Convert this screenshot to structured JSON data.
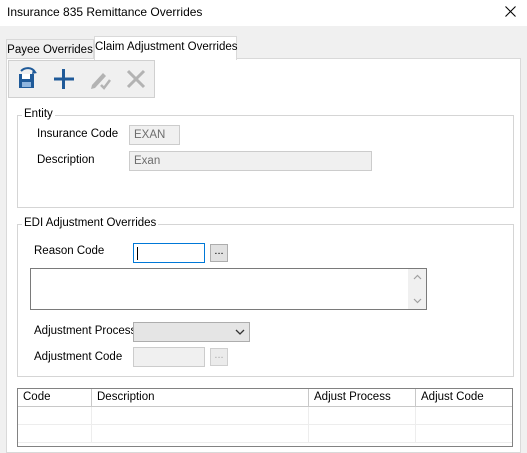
{
  "window": {
    "title": "Insurance 835 Remittance Overrides"
  },
  "tabs": [
    {
      "label": "Payee Overrides",
      "active": false
    },
    {
      "label": "Claim Adjustment Overrides",
      "active": true
    }
  ],
  "toolbar": {
    "buttons": [
      {
        "icon": "save-icon",
        "enabled": true
      },
      {
        "icon": "add-icon",
        "enabled": true
      },
      {
        "icon": "edit-icon",
        "enabled": false
      },
      {
        "icon": "delete-icon",
        "enabled": false
      }
    ]
  },
  "entity": {
    "group_label": "Entity",
    "insurance_code_label": "Insurance Code",
    "insurance_code_value": "EXAN",
    "description_label": "Description",
    "description_value": "Exan"
  },
  "edi": {
    "group_label": "EDI Adjustment Overrides",
    "reason_code_label": "Reason Code",
    "reason_code_value": "",
    "browse_label": "...",
    "adjustment_process_label": "Adjustment Process",
    "adjustment_process_value": "",
    "adjustment_code_label": "Adjustment Code",
    "adjustment_code_value": ""
  },
  "grid": {
    "columns": [
      "Code",
      "Description",
      "Adjust Process",
      "Adjust Code"
    ],
    "rows": [
      [
        "",
        "",
        "",
        ""
      ],
      [
        "",
        "",
        "",
        ""
      ]
    ]
  },
  "colors": {
    "accent": "#0078d7",
    "window_bg": "#f0f0f0",
    "panel_bg": "#ffffff",
    "save_icon": "#1f5a99",
    "add_icon": "#1f5a99"
  }
}
